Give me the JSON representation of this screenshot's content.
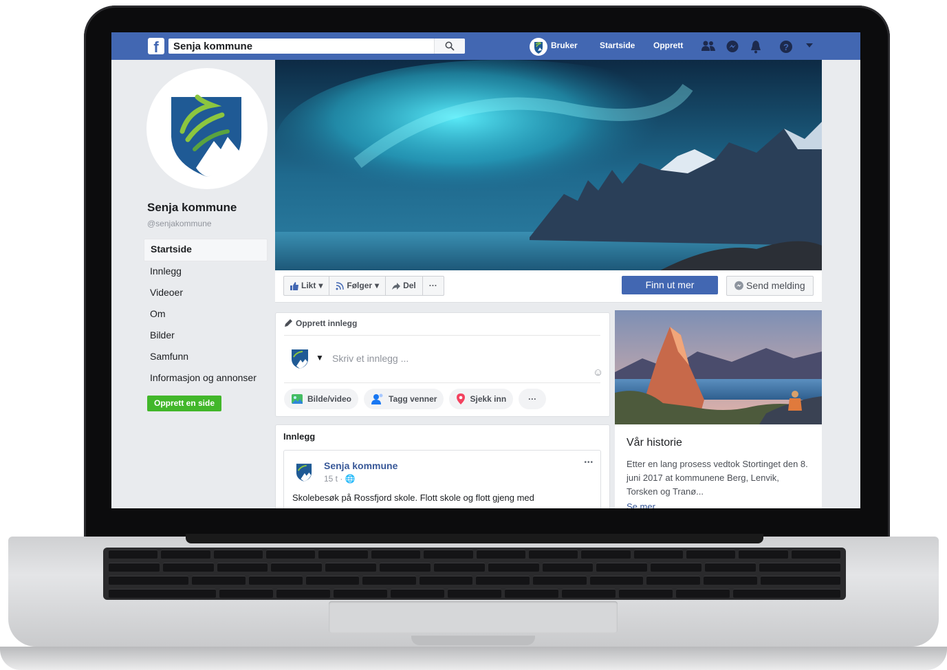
{
  "topbar": {
    "search_value": "Senja kommune",
    "user_label": "Bruker",
    "home_label": "Startside",
    "create_label": "Opprett"
  },
  "page": {
    "name": "Senja kommune",
    "handle": "@senjakommune",
    "menu": [
      "Startside",
      "Innlegg",
      "Videoer",
      "Om",
      "Bilder",
      "Samfunn",
      "Informasjon og annonser"
    ],
    "create_page_label": "Opprett en side"
  },
  "actions": {
    "like": "Likt",
    "follow": "Følger",
    "share": "Del",
    "more": "···",
    "learn_more": "Finn ut mer",
    "send_message": "Send melding"
  },
  "composer": {
    "title": "Opprett innlegg",
    "placeholder": "Skriv et innlegg ...",
    "photo": "Bilde/video",
    "tag": "Tagg venner",
    "checkin": "Sjekk inn",
    "more": "···"
  },
  "posts": {
    "title": "Innlegg",
    "first": {
      "author": "Senja kommune",
      "time": "15 t ·",
      "text": "Skolebesøk på Rossfjord skole. Flott skole og flott gjeng med",
      "more_dots": "•••"
    }
  },
  "story": {
    "title": "Vår historie",
    "text": "Etter en lang prosess vedtok Stortinget den 8. juni 2017 at kommunene Berg, Lenvik, Torsken og Tranø...",
    "more": "Se mer"
  },
  "colors": {
    "fb_blue": "#4267b2",
    "green": "#42b72a",
    "link": "#385898",
    "crest_blue": "#1f5a95",
    "crest_green": "#8cc63f"
  }
}
